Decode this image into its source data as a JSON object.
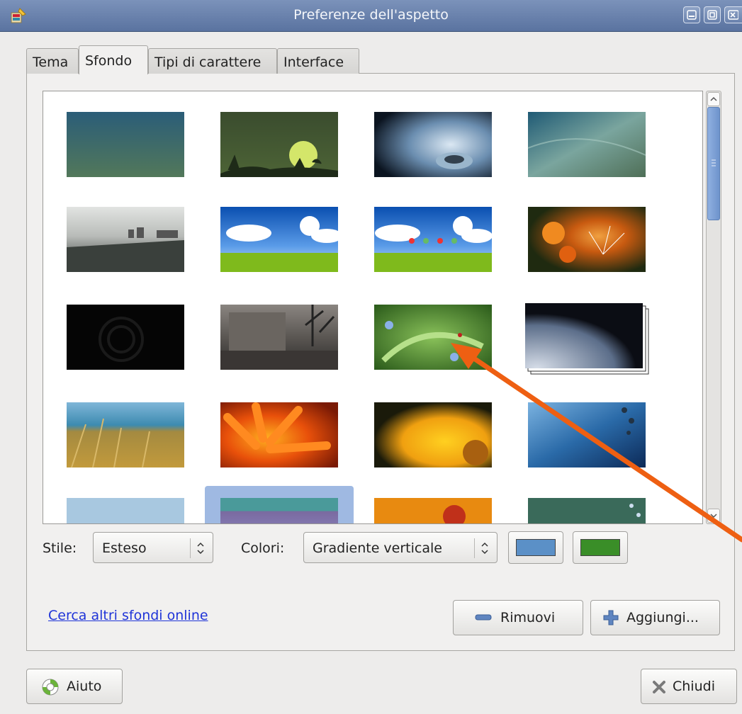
{
  "window": {
    "title": "Preferenze dell'aspetto",
    "controls": [
      "minimize-icon",
      "maximize-icon",
      "close-icon"
    ]
  },
  "tabs": [
    {
      "label": "Tema",
      "active": false
    },
    {
      "label": "Sfondo",
      "active": true
    },
    {
      "label": "Tipi di carattere",
      "active": false
    },
    {
      "label": "Interface",
      "active": false
    }
  ],
  "gallery": {
    "thumbnails": [
      {
        "name": "gradient-teal-green"
      },
      {
        "name": "dark-green-moon"
      },
      {
        "name": "water-drop"
      },
      {
        "name": "teal-soft-waves"
      },
      {
        "name": "beach-grayscale"
      },
      {
        "name": "blue-sky-meadow"
      },
      {
        "name": "blue-sky-meadow-icons"
      },
      {
        "name": "dandelion-orange"
      },
      {
        "name": "black-circles"
      },
      {
        "name": "sepia-street"
      },
      {
        "name": "green-leaves-ladybug"
      },
      {
        "name": "earth-from-space-stack"
      },
      {
        "name": "sea-grass"
      },
      {
        "name": "orange-flower"
      },
      {
        "name": "yellow-flower"
      },
      {
        "name": "blue-drops"
      },
      {
        "name": "sky-partial"
      },
      {
        "name": "selected-teal-purple",
        "selected": true
      },
      {
        "name": "orange-flowers-partial"
      },
      {
        "name": "teal-bubbles-partial"
      }
    ]
  },
  "controls": {
    "style_label": "Stile:",
    "style_value": "Esteso",
    "colors_label": "Colori:",
    "colors_value": "Gradiente verticale",
    "color1": "#5b90c7",
    "color2": "#3a8e28"
  },
  "actions": {
    "online_link": "Cerca altri sfondi online",
    "remove_label": "Rimuovi",
    "add_label": "Aggiungi...",
    "help_label": "Aiuto",
    "close_label": "Chiudi"
  }
}
